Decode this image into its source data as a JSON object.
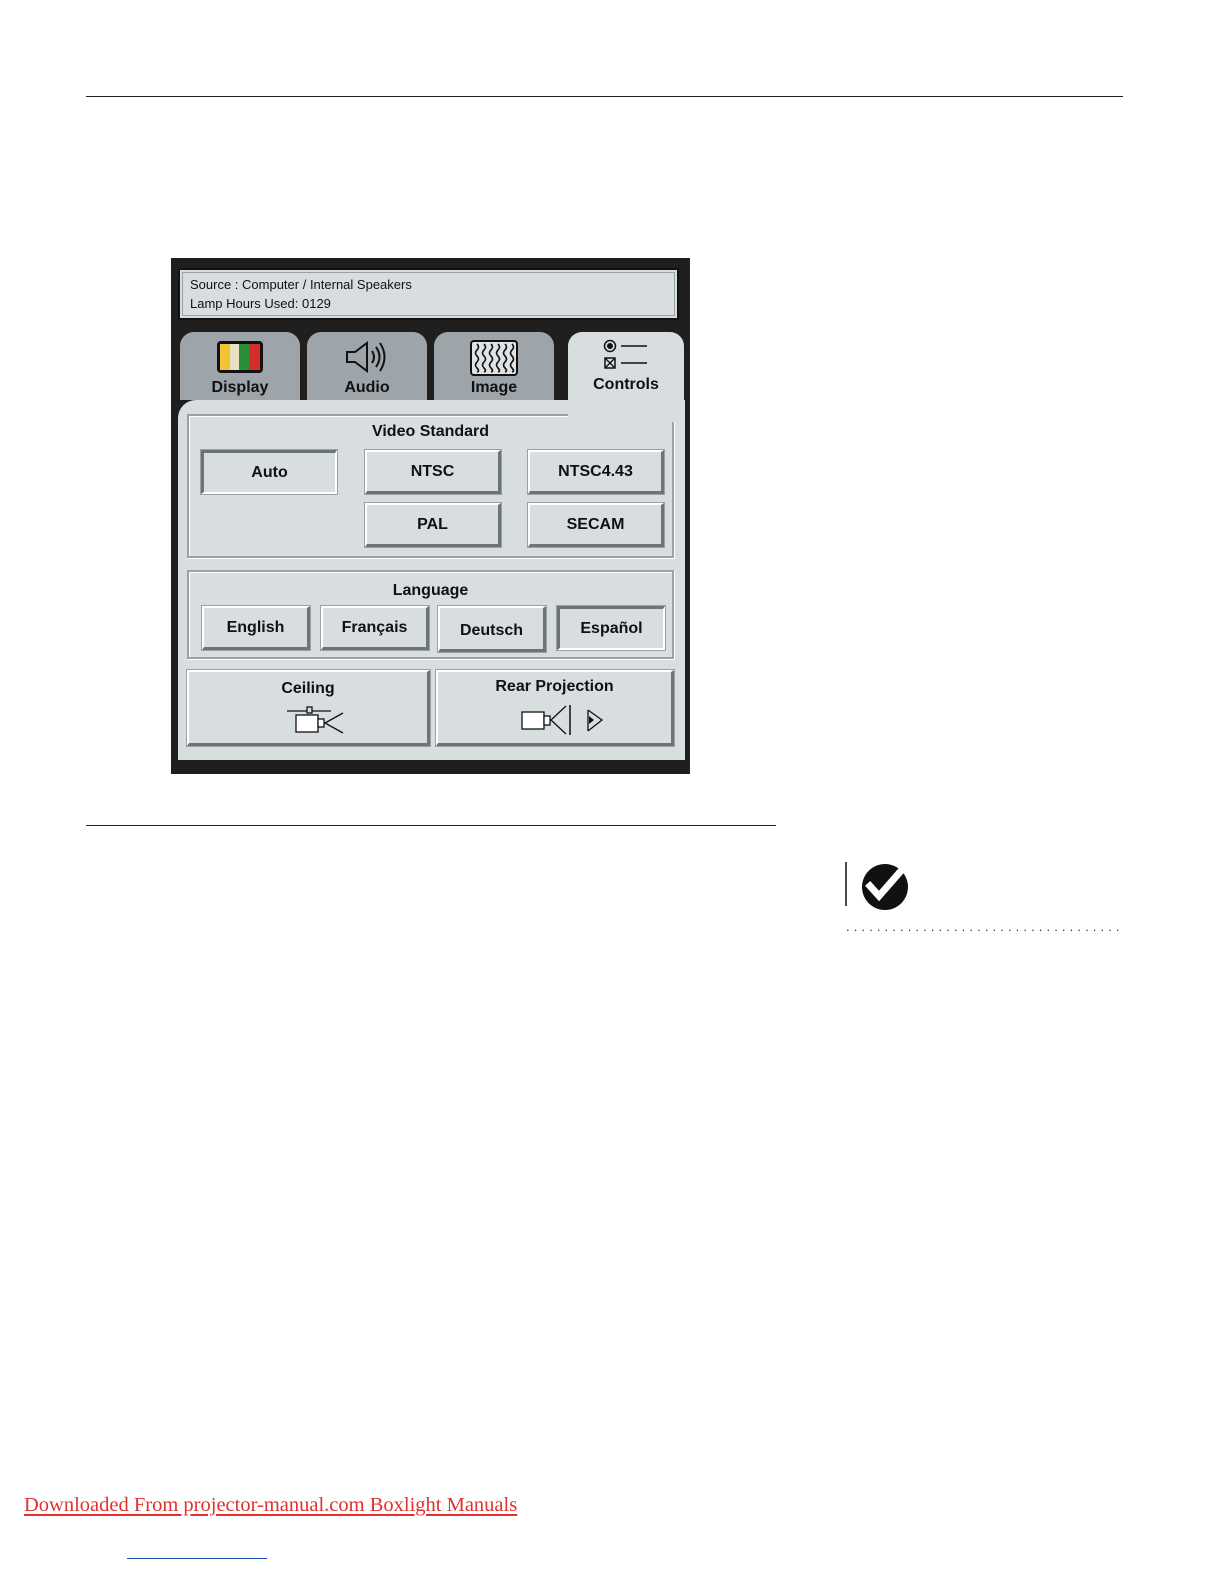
{
  "status": {
    "source_line": "Source : Computer / Internal Speakers",
    "lamp_line": "Lamp Hours Used: 0129"
  },
  "tabs": [
    {
      "label": "Display",
      "icon": "color-bars-icon"
    },
    {
      "label": "Audio",
      "icon": "speaker-icon"
    },
    {
      "label": "Image",
      "icon": "wavy-image-icon"
    },
    {
      "label": "Controls",
      "icon": "radio-checkbox-icon",
      "active": true
    }
  ],
  "video_standard": {
    "title": "Video Standard",
    "options": [
      "Auto",
      "NTSC",
      "NTSC4.43",
      "PAL",
      "SECAM"
    ],
    "selected": "Auto"
  },
  "language": {
    "title": "Language",
    "options": [
      "English",
      "Français",
      "Deutsch",
      "Español"
    ],
    "selected": "Español"
  },
  "ceiling": {
    "label": "Ceiling",
    "icon": "ceiling-projector-icon"
  },
  "rear_projection": {
    "label": "Rear Projection",
    "icon": "rear-projection-icon"
  },
  "footer": {
    "link_text": "Downloaded From projector-manual.com Boxlight Manuals"
  },
  "colors": {
    "footer_link": "#e0312e",
    "panel": "#d8dde0",
    "tab_inactive": "#9ea5aa",
    "menu_frame": "#1f1f1f"
  }
}
